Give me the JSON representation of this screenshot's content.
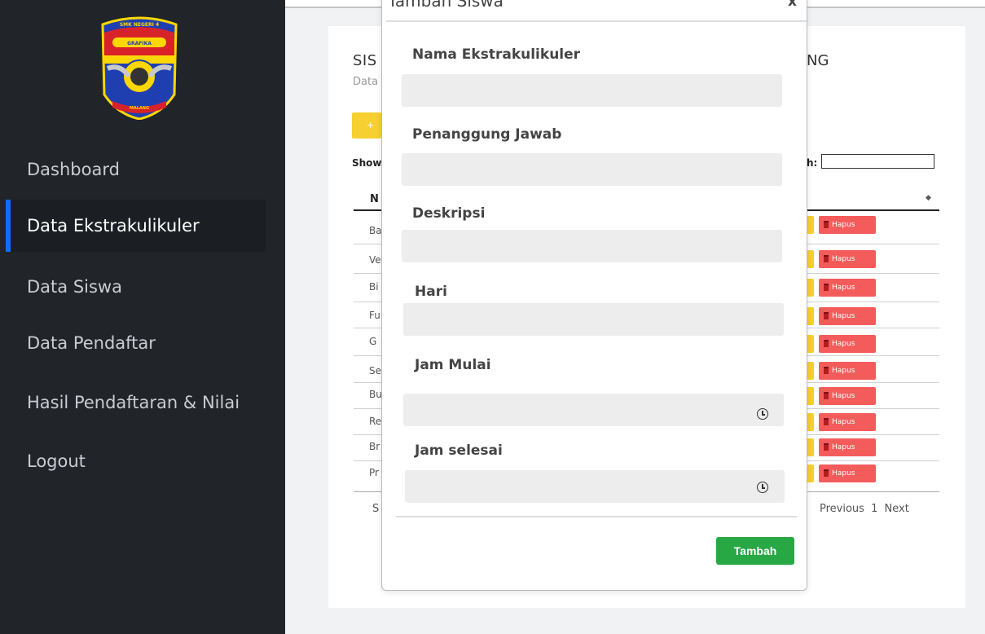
{
  "sidebar": {
    "logo": {
      "text_top": "SMK NEGERI 4",
      "text_band": "GRAFIKA",
      "text_ribbon": "MALANG",
      "colors": {
        "blue": "#1f3fb0",
        "red": "#d8222a",
        "yellow": "#ffd700"
      }
    },
    "items": [
      {
        "label": "Dashboard",
        "active": false
      },
      {
        "label": "Data Ekstrakulikuler",
        "active": true
      },
      {
        "label": "Data Siswa",
        "active": false
      },
      {
        "label": "Data Pendaftar",
        "active": false
      },
      {
        "label": "Hasil Pendaftaran & Nilai",
        "active": false
      },
      {
        "label": "Logout",
        "active": false
      }
    ]
  },
  "page": {
    "title_start": "SIS",
    "title_end": "NG",
    "subtitle": "Data",
    "add_button_label": "+",
    "show_label": "Show",
    "search_label": "h:",
    "column_header": "N",
    "rows": [
      {
        "name": "Ba",
        "delete_label": "Hapus"
      },
      {
        "name": "Ve",
        "delete_label": "Hapus"
      },
      {
        "name": "Bi",
        "delete_label": "Hapus"
      },
      {
        "name": "Fu",
        "delete_label": "Hapus"
      },
      {
        "name": "G",
        "delete_label": "Hapus"
      },
      {
        "name": "Se",
        "delete_label": "Hapus"
      },
      {
        "name": "Bu",
        "delete_label": "Hapus"
      },
      {
        "name": "Re",
        "delete_label": "Hapus"
      },
      {
        "name": "Br",
        "delete_label": "Hapus"
      },
      {
        "name": "Pr",
        "delete_label": "Hapus"
      }
    ],
    "showing_text": "S",
    "pagination": {
      "previous": "Previous",
      "current": "1",
      "next": "Next"
    }
  },
  "modal": {
    "title": "Tambah Siswa",
    "close_label": "x",
    "fields": [
      {
        "label": "Nama Ekstrakulikuler",
        "value": ""
      },
      {
        "label": "Penanggung Jawab",
        "value": ""
      },
      {
        "label": "Deskripsi",
        "value": ""
      },
      {
        "label": "Hari",
        "value": ""
      },
      {
        "label": "Jam Mulai",
        "value": ""
      },
      {
        "label": "Jam selesai",
        "value": ""
      }
    ],
    "submit_label": "Tambah"
  }
}
